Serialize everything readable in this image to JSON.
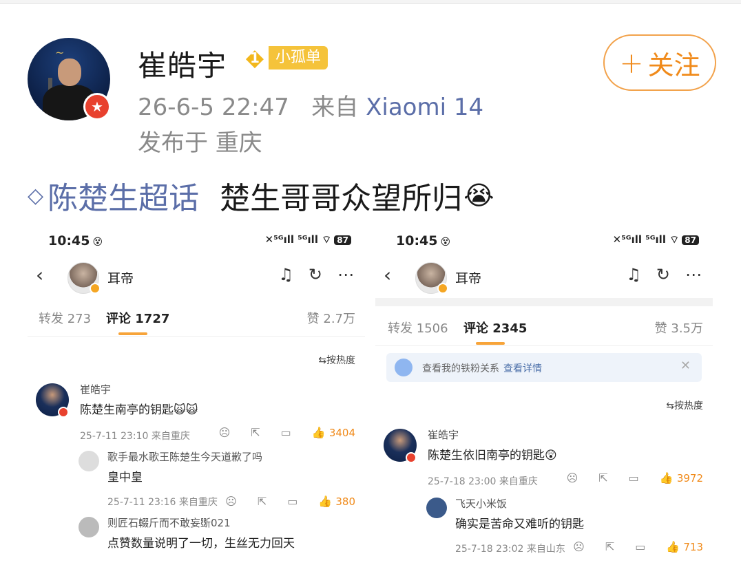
{
  "post": {
    "username": "崔皓宇",
    "fan_level": "1",
    "fan_label": "小孤单",
    "follow_label": "关注",
    "follow_plus": "+",
    "time": "26-6-5 22:47",
    "source_prefix": "来自",
    "device": "Xiaomi 14",
    "location": "发布于 重庆",
    "topic": "陈楚生超话",
    "text": "楚生哥哥众望所归",
    "emoji": "😭"
  },
  "screens": [
    {
      "status_time": "10:45",
      "status_right": "✕⁵ᴳıll ⁵ᴳıll ⌔",
      "battery": "87",
      "nav_title": "耳帝",
      "tabs": {
        "repost": "转发 273",
        "comment": "评论 1727",
        "like": "赞 2.7万"
      },
      "sort": "⇆按热度",
      "comment": {
        "name": "崔皓宇",
        "text": "陈楚生南亭的钥匙🙀🙀",
        "meta": "25-7-11 23:10  来自重庆",
        "likes": "3404"
      },
      "replies": [
        {
          "name": "歌手最水歌王陈楚生今天道歉了吗",
          "text": "皇中皇",
          "meta": "25-7-11 23:16  来自重庆",
          "likes": "380"
        },
        {
          "name": "则匠石輟斤而不敢妄斲021",
          "text": "点赞数量说明了一切，生丝无力回天",
          "meta": "",
          "likes": ""
        }
      ]
    },
    {
      "status_time": "10:45",
      "status_right": "✕⁵ᴳıll ⁵ᴳıll ⌔",
      "battery": "87",
      "nav_title": "耳帝",
      "tabs": {
        "repost": "转发 1506",
        "comment": "评论 2345",
        "like": "赞 3.5万"
      },
      "banner": {
        "text": "查看我的铁粉关系",
        "link": "查看详情"
      },
      "sort": "⇆按热度",
      "comment": {
        "name": "崔皓宇",
        "text": "陈楚生依旧南亭的钥匙😲",
        "meta": "25-7-18 23:00  来自重庆",
        "likes": "3972"
      },
      "replies": [
        {
          "name": "飞天小米饭",
          "text": "确实是苦命又难听的钥匙",
          "meta": "25-7-18 23:02  来自山东",
          "likes": "713"
        }
      ]
    }
  ],
  "colors": {
    "accent": "#f08a1a",
    "link": "#5b6ea8",
    "badge": "#f5c33a"
  }
}
